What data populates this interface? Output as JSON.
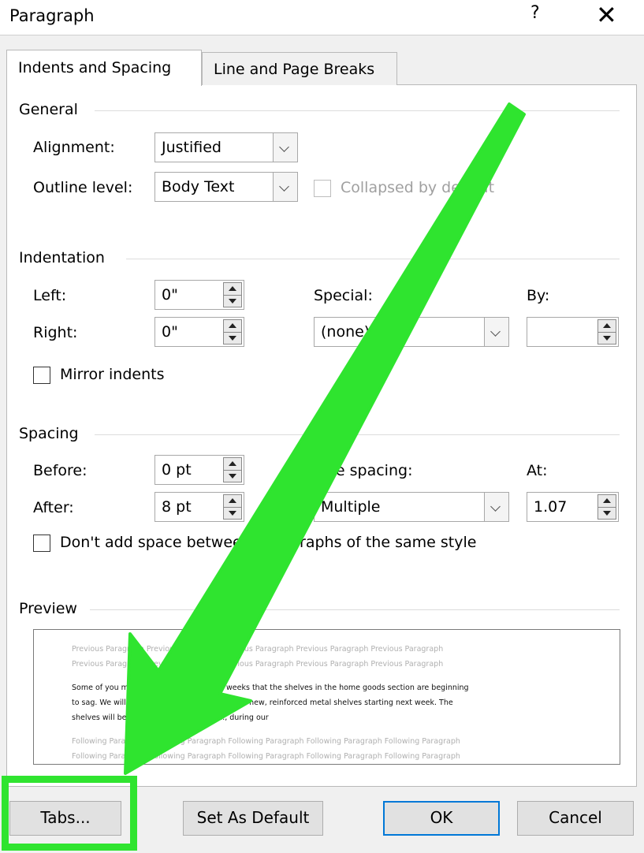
{
  "dialog": {
    "title": "Paragraph",
    "help_label": "?",
    "close_label": "✕"
  },
  "tabs": [
    {
      "label": "Indents and Spacing",
      "active": true
    },
    {
      "label": "Line and Page Breaks",
      "active": false
    }
  ],
  "general": {
    "title": "General",
    "alignment_label": "Alignment:",
    "alignment_value": "Justified",
    "outline_label": "Outline level:",
    "outline_value": "Body Text",
    "collapsed_label": "Collapsed by default",
    "collapsed_checked": false
  },
  "indentation": {
    "title": "Indentation",
    "left_label": "Left:",
    "left_value": "0\"",
    "right_label": "Right:",
    "right_value": "0\"",
    "special_label": "Special:",
    "special_value": "(none)",
    "by_label": "By:",
    "by_value": "",
    "mirror_label": "Mirror indents",
    "mirror_checked": false
  },
  "spacing": {
    "title": "Spacing",
    "before_label": "Before:",
    "before_value": "0 pt",
    "after_label": "After:",
    "after_value": "8 pt",
    "line_spacing_label": "Line spacing:",
    "line_spacing_value": "Multiple",
    "at_label": "At:",
    "at_value": "1.07",
    "dont_add_label": "Don't add space between paragraphs of the same style",
    "dont_add_checked": false
  },
  "preview": {
    "title": "Preview",
    "previous_1": "Previous Paragraph Previous Paragraph Previous Paragraph Previous Paragraph Previous Paragraph",
    "previous_2": "Previous Paragraph Previous Paragraph Previous Paragraph Previous Paragraph Previous Paragraph",
    "body_1": "Some of you may have noticed in recent weeks that the shelves in the home goods section are beginning",
    "body_2": "to sag. We will be replacing those shelves with new, reinforced metal shelves starting next week. The",
    "body_3": "shelves will be replaced 12:00–4:00 a.m., during our",
    "following_1": "Following Paragraph Following Paragraph Following Paragraph Following Paragraph Following Paragraph",
    "following_2": "Following Paragraph Following Paragraph Following Paragraph Following Paragraph Following Paragraph"
  },
  "buttons": {
    "tabs_label": "Tabs...",
    "set_default_label": "Set As Default",
    "ok_label": "OK",
    "cancel_label": "Cancel"
  },
  "colors": {
    "annotation_green": "#2fe42f",
    "ok_border": "#0078d7"
  }
}
